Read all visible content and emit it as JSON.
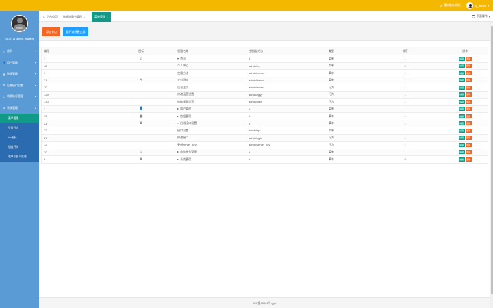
{
  "topbar": {
    "link_text": "清除缓存/刷新",
    "user_name": "yy_admin"
  },
  "sidebar": {
    "avatar_caption": "管理员",
    "user_line": "(NO.1) yy_admin, 超级管理",
    "menu": [
      {
        "icon": "home-icon",
        "glyph": "⌂",
        "label": "首页",
        "caret": "down"
      },
      {
        "icon": "user-icon",
        "glyph": "👤",
        "label": "用户管理",
        "caret": "down"
      },
      {
        "icon": "list-icon",
        "glyph": "▦",
        "label": "数据管理",
        "caret": "down"
      },
      {
        "icon": "gear-icon",
        "glyph": "⚙",
        "label": "后端接口设置",
        "caret": "down"
      },
      {
        "icon": "cup-icon",
        "glyph": "♨",
        "label": "收款账号管理",
        "caret": "down"
      },
      {
        "icon": "settings-icon",
        "glyph": "⚙",
        "label": "系统管理",
        "caret": "up"
      }
    ],
    "submenu": [
      {
        "label": "菜单管理",
        "active": true
      },
      {
        "label": "登录日志",
        "active": false
      },
      {
        "label": "ico图标",
        "active": false
      },
      {
        "label": "通道开关",
        "active": false
      },
      {
        "label": "收单机器人管理",
        "active": false
      }
    ]
  },
  "tabs": [
    {
      "label": "后台首页",
      "icon": "home-icon"
    },
    {
      "label": "数据流量分管理",
      "icon": ""
    },
    {
      "label": "菜单管理",
      "icon": ""
    }
  ],
  "page_ops": "页面操作",
  "toolbar": {
    "add_label": "添加节点",
    "toggle_label": "展开或折叠全部"
  },
  "table": {
    "headers": [
      "编号",
      "图标",
      "权限名称",
      "控制器/方法",
      "类型",
      "排序",
      "操作"
    ],
    "rows": [
      {
        "id": "1",
        "icon": "⌂",
        "name": "首页",
        "level": 0,
        "expanded": "down",
        "path": "#",
        "type": "菜单",
        "sort": "1"
      },
      {
        "id": "45",
        "icon": "",
        "name": "个人中心",
        "level": 1,
        "expanded": "",
        "path": "admin/my",
        "type": "菜单",
        "sort": "2"
      },
      {
        "id": "9",
        "icon": "",
        "name": "使用方法",
        "level": 1,
        "expanded": "",
        "path": "admin/home",
        "type": "菜单",
        "sort": "1"
      },
      {
        "id": "31",
        "icon": "✎",
        "name": "支付测试",
        "level": 1,
        "expanded": "",
        "path": "admin/demo",
        "type": "菜单",
        "sort": "1"
      },
      {
        "id": "70",
        "icon": "",
        "name": "后台主页",
        "level": 1,
        "expanded": "",
        "path": "admin/index",
        "type": "行为",
        "sort": "1"
      },
      {
        "id": "129",
        "icon": "",
        "name": "修改运营设置",
        "level": 1,
        "expanded": "",
        "path": "admin/xgyy",
        "type": "行为",
        "sort": "1"
      },
      {
        "id": "130",
        "icon": "",
        "name": "修改标题设置",
        "level": 1,
        "expanded": "",
        "path": "admin/xgbt",
        "type": "行为",
        "sort": "1"
      },
      {
        "id": "2",
        "icon": "👤",
        "name": "用户管理",
        "level": 0,
        "expanded": "right",
        "path": "#",
        "type": "菜单",
        "sort": "1"
      },
      {
        "id": "15",
        "icon": "▦",
        "name": "数据管理",
        "level": 0,
        "expanded": "right",
        "path": "#",
        "type": "菜单",
        "sort": "1"
      },
      {
        "id": "21",
        "icon": "⚙",
        "name": "后端接口设置",
        "level": 0,
        "expanded": "down",
        "path": "#",
        "type": "菜单",
        "sort": "1"
      },
      {
        "id": "22",
        "icon": "",
        "name": "接口设置",
        "level": 1,
        "expanded": "",
        "path": "admin/api",
        "type": "菜单",
        "sort": "1"
      },
      {
        "id": "27",
        "icon": "",
        "name": "修改接口",
        "level": 1,
        "expanded": "",
        "path": "admin/xgjk",
        "type": "行为",
        "sort": "1"
      },
      {
        "id": "72",
        "icon": "",
        "name": "更新server_key",
        "level": 1,
        "expanded": "",
        "path": "admin/server_key",
        "type": "行为",
        "sort": "1"
      },
      {
        "id": "20",
        "icon": "♨",
        "name": "收款账号管理",
        "level": 0,
        "expanded": "right",
        "path": "#",
        "type": "菜单",
        "sort": "1"
      },
      {
        "id": "6",
        "icon": "⚙",
        "name": "系统管理",
        "level": 0,
        "expanded": "right",
        "path": "#",
        "type": "菜单",
        "sort": "3"
      }
    ],
    "edit_label": "编辑",
    "delete_label": "删除"
  },
  "footer": "ICP备00001号-yyk"
}
